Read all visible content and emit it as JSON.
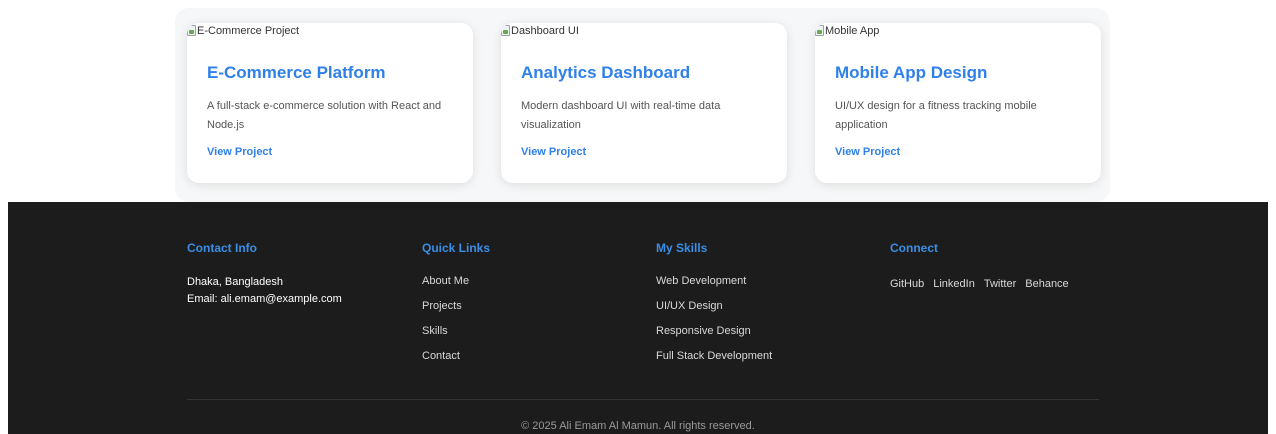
{
  "projects": [
    {
      "image_alt": "E-Commerce Project",
      "title": "E-Commerce Platform",
      "description": "A full-stack e-commerce solution with React and Node.js",
      "link_label": "View Project"
    },
    {
      "image_alt": "Dashboard UI",
      "title": "Analytics Dashboard",
      "description": "Modern dashboard UI with real-time data visualization",
      "link_label": "View Project"
    },
    {
      "image_alt": "Mobile App",
      "title": "Mobile App Design",
      "description": "UI/UX design for a fitness tracking mobile application",
      "link_label": "View Project"
    }
  ],
  "footer": {
    "contact": {
      "title": "Contact Info",
      "location": "Dhaka, Bangladesh",
      "email": "Email: ali.emam@example.com"
    },
    "quick_links": {
      "title": "Quick Links",
      "items": [
        "About Me",
        "Projects",
        "Skills",
        "Contact"
      ]
    },
    "skills": {
      "title": "My Skills",
      "items": [
        "Web Development",
        "UI/UX Design",
        "Responsive Design",
        "Full Stack Development"
      ]
    },
    "connect": {
      "title": "Connect",
      "items": [
        "GitHub",
        "LinkedIn",
        "Twitter",
        "Behance"
      ]
    },
    "copyright": "© 2025 Ali Emam Al Mamun. All rights reserved."
  },
  "colors": {
    "accent": "#2f80e8",
    "footer_bg": "#1c1c1c",
    "footer_heading": "#3a8ee6"
  }
}
